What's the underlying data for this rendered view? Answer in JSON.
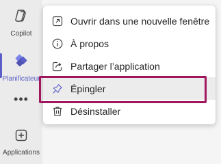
{
  "rail": {
    "items": [
      {
        "label": "Copilot",
        "icon": "copilot-icon"
      },
      {
        "label": "Planificateur",
        "icon": "planner-icon"
      },
      {
        "label": "Applications",
        "icon": "add-apps-icon"
      }
    ],
    "more": "•••"
  },
  "menu": {
    "items": [
      {
        "label": "Ouvrir dans une nouvelle fenêtre",
        "icon": "open-new-window-icon"
      },
      {
        "label": "À propos",
        "icon": "info-icon"
      },
      {
        "label": "Partager l’application",
        "icon": "share-icon"
      },
      {
        "label": "Épingler",
        "icon": "pin-icon"
      },
      {
        "label": "Désinstaller",
        "icon": "trash-icon"
      }
    ]
  },
  "colors": {
    "accent": "#5b5fc7",
    "highlight_border": "#a0175e"
  }
}
